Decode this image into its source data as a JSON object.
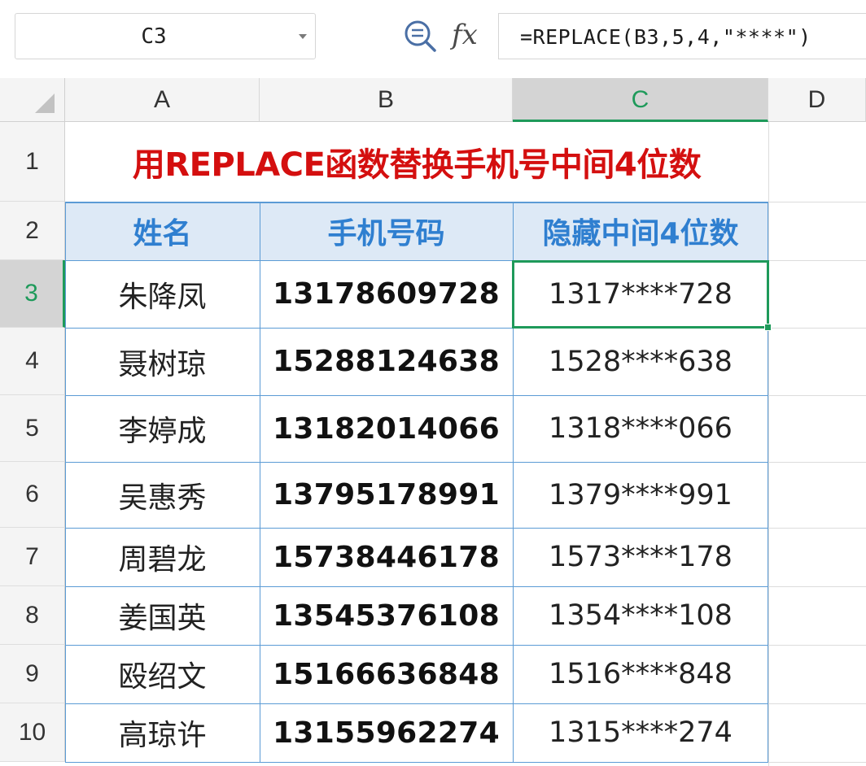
{
  "formula_bar": {
    "name_box": "C3",
    "fx_label": "fx",
    "formula": "=REPLACE(B3,5,4,\"****\")",
    "zoom_icon": "zoom-formula-icon",
    "dropdown_icon": "chevron-down-icon"
  },
  "columns": [
    "A",
    "B",
    "C",
    "D"
  ],
  "row_numbers": [
    "1",
    "2",
    "3",
    "4",
    "5",
    "6",
    "7",
    "8",
    "9",
    "10"
  ],
  "sheet": {
    "title": "用REPLACE函数替换手机号中间4位数",
    "headers": [
      "姓名",
      "手机号码",
      "隐藏中间4位数"
    ],
    "rows": [
      [
        "朱降凤",
        "13178609728",
        "1317****728"
      ],
      [
        "聂树琼",
        "15288124638",
        "1528****638"
      ],
      [
        "李婷成",
        "13182014066",
        "1318****066"
      ],
      [
        "吴惠秀",
        "13795178991",
        "1379****991"
      ],
      [
        "周碧龙",
        "15738446178",
        "1573****178"
      ],
      [
        "姜国英",
        "13545376108",
        "1354****108"
      ],
      [
        "殴绍文",
        "15166636848",
        "1516****848"
      ],
      [
        "高琼许",
        "13155962274",
        "1315****274"
      ]
    ]
  },
  "selected_cell": "C3",
  "colors": {
    "title": "#d40f0f",
    "header_text": "#2f7fd0",
    "header_fill": "#dde9f6",
    "selection": "#1e9a5a",
    "table_border": "#5b9bd5"
  }
}
